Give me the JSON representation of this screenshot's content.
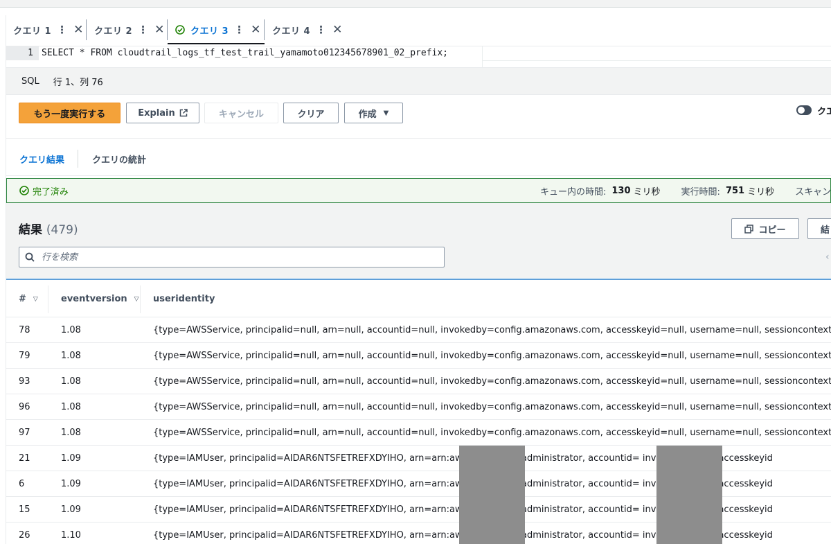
{
  "tabs": [
    {
      "label": "クエリ 1",
      "active": false,
      "status": ""
    },
    {
      "label": "クエリ 2",
      "active": false,
      "status": ""
    },
    {
      "label": "クエリ 3",
      "active": true,
      "status": "completed"
    },
    {
      "label": "クエリ 4",
      "active": false,
      "status": ""
    }
  ],
  "tab_icons": {
    "more": "⋮",
    "close": "✕"
  },
  "editor": {
    "line_number": "1",
    "code": "SELECT * FROM cloudtrail_logs_tf_test_trail_yamamoto012345678901_02_prefix;"
  },
  "status_bar": {
    "language": "SQL",
    "cursor": "行 1、列 76"
  },
  "actions": {
    "run_again": "もう一度実行する",
    "explain": "Explain",
    "cancel": "キャンセル",
    "clear": "クリア",
    "create": "作成",
    "toggle_label": "クエ"
  },
  "result_tabs": {
    "results": "クエリ結果",
    "stats": "クエリの統計"
  },
  "banner": {
    "status": "完了済み",
    "queue_label": "キュー内の時間:",
    "queue_value": "130",
    "queue_unit": "ミリ秒",
    "run_label": "実行時間:",
    "run_value": "751",
    "run_unit": "ミリ秒",
    "scan_label": "スキャンし"
  },
  "results": {
    "title": "結果",
    "count": "(479)",
    "copy": "コピー",
    "save": "結",
    "search_placeholder": "行を検索"
  },
  "table": {
    "columns": [
      "#",
      "eventversion",
      "useridentity"
    ],
    "rows": [
      {
        "n": "78",
        "v": "1.08",
        "u": "{type=AWSService, principalid=null, arn=null, accountid=null, invokedby=config.amazonaws.com, accesskeyid=null, username=null, sessioncontext=null}"
      },
      {
        "n": "79",
        "v": "1.08",
        "u": "{type=AWSService, principalid=null, arn=null, accountid=null, invokedby=config.amazonaws.com, accesskeyid=null, username=null, sessioncontext=null}"
      },
      {
        "n": "93",
        "v": "1.08",
        "u": "{type=AWSService, principalid=null, arn=null, accountid=null, invokedby=config.amazonaws.com, accesskeyid=null, username=null, sessioncontext=null}"
      },
      {
        "n": "96",
        "v": "1.08",
        "u": "{type=AWSService, principalid=null, arn=null, accountid=null, invokedby=config.amazonaws.com, accesskeyid=null, username=null, sessioncontext=null}"
      },
      {
        "n": "97",
        "v": "1.08",
        "u": "{type=AWSService, principalid=null, arn=null, accountid=null, invokedby=config.amazonaws.com, accesskeyid=null, username=null, sessioncontext=null}"
      },
      {
        "n": "21",
        "v": "1.09",
        "u": "{type=IAMUser, principalid=AIDAR6NTSFETREFXDYIHO, arn=arn:aws:iam::            :user/administrator, accountid=            invokedby=null, accesskeyid"
      },
      {
        "n": "6",
        "v": "1.09",
        "u": "{type=IAMUser, principalid=AIDAR6NTSFETREFXDYIHO, arn=arn:aws:iam::            :user/administrator, accountid=            invokedby=null, accesskeyid"
      },
      {
        "n": "15",
        "v": "1.09",
        "u": "{type=IAMUser, principalid=AIDAR6NTSFETREFXDYIHO, arn=arn:aws:iam::            :user/administrator, accountid=            invokedby=null, accesskeyid"
      },
      {
        "n": "26",
        "v": "1.10",
        "u": "{type=IAMUser, principalid=AIDAR6NTSFETREFXDYIHO, arn=arn:aws:iam::            :user/administrator, accountid=            invokedby=null, accesskeyid"
      }
    ]
  },
  "colors": {
    "primary": "#f4a23a",
    "link": "#0972d3",
    "success": "#1d8102",
    "redact": "#8d8d8d"
  }
}
